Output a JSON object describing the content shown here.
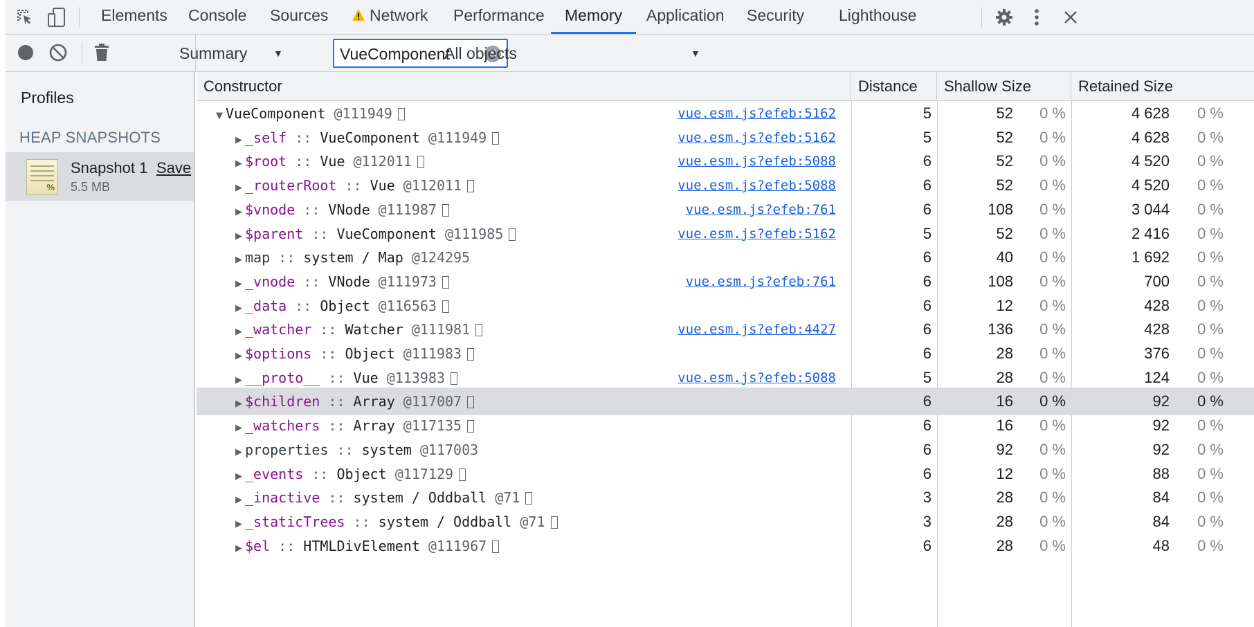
{
  "tabs": [
    "Elements",
    "Console",
    "Sources",
    "Network",
    "Performance",
    "Memory",
    "Application",
    "Security",
    "Lighthouse"
  ],
  "active_tab": "Memory",
  "toolbar": {
    "view_select": "Summary",
    "filter_value": "VueComponent",
    "objects_select": "All objects"
  },
  "sidebar": {
    "title": "Profiles",
    "section": "HEAP SNAPSHOTS",
    "snapshot_name": "Snapshot 1",
    "snapshot_save": "Save",
    "snapshot_size": "5.5 MB"
  },
  "columns": {
    "constructor": "Constructor",
    "distance": "Distance",
    "shallow": "Shallow Size",
    "retained": "Retained Size"
  },
  "colors": {
    "accent": "#1a73e8",
    "property": "#881391",
    "link": "#1a5fd8",
    "warning": "#f4b400"
  },
  "rows": [
    {
      "expanded": true,
      "indent": 0,
      "prop": "",
      "ctor": "VueComponent",
      "id": "@111949",
      "link": "vue.esm.js?efeb:5162",
      "distance": "5",
      "shallow": "52",
      "shallow_pct": "0 %",
      "retained": "4 628",
      "retained_pct": "0 %"
    },
    {
      "indent": 1,
      "prop": "_self",
      "ctor": "VueComponent",
      "id": "@111949",
      "link": "vue.esm.js?efeb:5162",
      "distance": "5",
      "shallow": "52",
      "shallow_pct": "0 %",
      "retained": "4 628",
      "retained_pct": "0 %"
    },
    {
      "indent": 1,
      "prop": "$root",
      "ctor": "Vue",
      "id": "@112011",
      "link": "vue.esm.js?efeb:5088",
      "distance": "6",
      "shallow": "52",
      "shallow_pct": "0 %",
      "retained": "4 520",
      "retained_pct": "0 %"
    },
    {
      "indent": 1,
      "prop": "_routerRoot",
      "ctor": "Vue",
      "id": "@112011",
      "link": "vue.esm.js?efeb:5088",
      "distance": "6",
      "shallow": "52",
      "shallow_pct": "0 %",
      "retained": "4 520",
      "retained_pct": "0 %"
    },
    {
      "indent": 1,
      "prop": "$vnode",
      "ctor": "VNode",
      "id": "@111987",
      "link": "vue.esm.js?efeb:761",
      "distance": "6",
      "shallow": "108",
      "shallow_pct": "0 %",
      "retained": "3 044",
      "retained_pct": "0 %"
    },
    {
      "indent": 1,
      "prop": "$parent",
      "ctor": "VueComponent",
      "id": "@111985",
      "link": "vue.esm.js?efeb:5162",
      "distance": "5",
      "shallow": "52",
      "shallow_pct": "0 %",
      "retained": "2 416",
      "retained_pct": "0 %"
    },
    {
      "indent": 1,
      "prop": "map",
      "sys": true,
      "noBox": true,
      "ctor": "system / Map",
      "id": "@124295",
      "link": "",
      "distance": "6",
      "shallow": "40",
      "shallow_pct": "0 %",
      "retained": "1 692",
      "retained_pct": "0 %"
    },
    {
      "indent": 1,
      "prop": "_vnode",
      "ctor": "VNode",
      "id": "@111973",
      "link": "vue.esm.js?efeb:761",
      "distance": "6",
      "shallow": "108",
      "shallow_pct": "0 %",
      "retained": "700",
      "retained_pct": "0 %"
    },
    {
      "indent": 1,
      "prop": "_data",
      "ctor": "Object",
      "id": "@116563",
      "link": "",
      "distance": "6",
      "shallow": "12",
      "shallow_pct": "0 %",
      "retained": "428",
      "retained_pct": "0 %"
    },
    {
      "indent": 1,
      "prop": "_watcher",
      "ctor": "Watcher",
      "id": "@111981",
      "link": "vue.esm.js?efeb:4427",
      "distance": "6",
      "shallow": "136",
      "shallow_pct": "0 %",
      "retained": "428",
      "retained_pct": "0 %"
    },
    {
      "indent": 1,
      "prop": "$options",
      "ctor": "Object",
      "id": "@111983",
      "link": "",
      "distance": "6",
      "shallow": "28",
      "shallow_pct": "0 %",
      "retained": "376",
      "retained_pct": "0 %"
    },
    {
      "indent": 1,
      "prop": "__proto__",
      "ctor": "Vue",
      "id": "@113983",
      "link": "vue.esm.js?efeb:5088",
      "distance": "5",
      "shallow": "28",
      "shallow_pct": "0 %",
      "retained": "124",
      "retained_pct": "0 %"
    },
    {
      "indent": 1,
      "selected": true,
      "prop": "$children",
      "ctor": "Array",
      "id": "@117007",
      "link": "",
      "distance": "6",
      "shallow": "16",
      "shallow_pct": "0 %",
      "retained": "92",
      "retained_pct": "0 %"
    },
    {
      "indent": 1,
      "prop": "_watchers",
      "ctor": "Array",
      "id": "@117135",
      "link": "",
      "distance": "6",
      "shallow": "16",
      "shallow_pct": "0 %",
      "retained": "92",
      "retained_pct": "0 %"
    },
    {
      "indent": 1,
      "prop": "properties",
      "sys": true,
      "noBox": true,
      "ctor": "system",
      "id": "@117003",
      "link": "",
      "distance": "6",
      "shallow": "92",
      "shallow_pct": "0 %",
      "retained": "92",
      "retained_pct": "0 %"
    },
    {
      "indent": 1,
      "prop": "_events",
      "ctor": "Object",
      "id": "@117129",
      "link": "",
      "distance": "6",
      "shallow": "12",
      "shallow_pct": "0 %",
      "retained": "88",
      "retained_pct": "0 %"
    },
    {
      "indent": 1,
      "prop": "_inactive",
      "ctor": "system / Oddball",
      "id": "@71",
      "link": "",
      "distance": "3",
      "shallow": "28",
      "shallow_pct": "0 %",
      "retained": "84",
      "retained_pct": "0 %"
    },
    {
      "indent": 1,
      "prop": "_staticTrees",
      "ctor": "system / Oddball",
      "id": "@71",
      "link": "",
      "distance": "3",
      "shallow": "28",
      "shallow_pct": "0 %",
      "retained": "84",
      "retained_pct": "0 %"
    },
    {
      "indent": 1,
      "prop": "$el",
      "ctor": "HTMLDivElement",
      "id": "@111967",
      "link": "",
      "distance": "6",
      "shallow": "28",
      "shallow_pct": "0 %",
      "retained": "48",
      "retained_pct": "0 %"
    }
  ]
}
